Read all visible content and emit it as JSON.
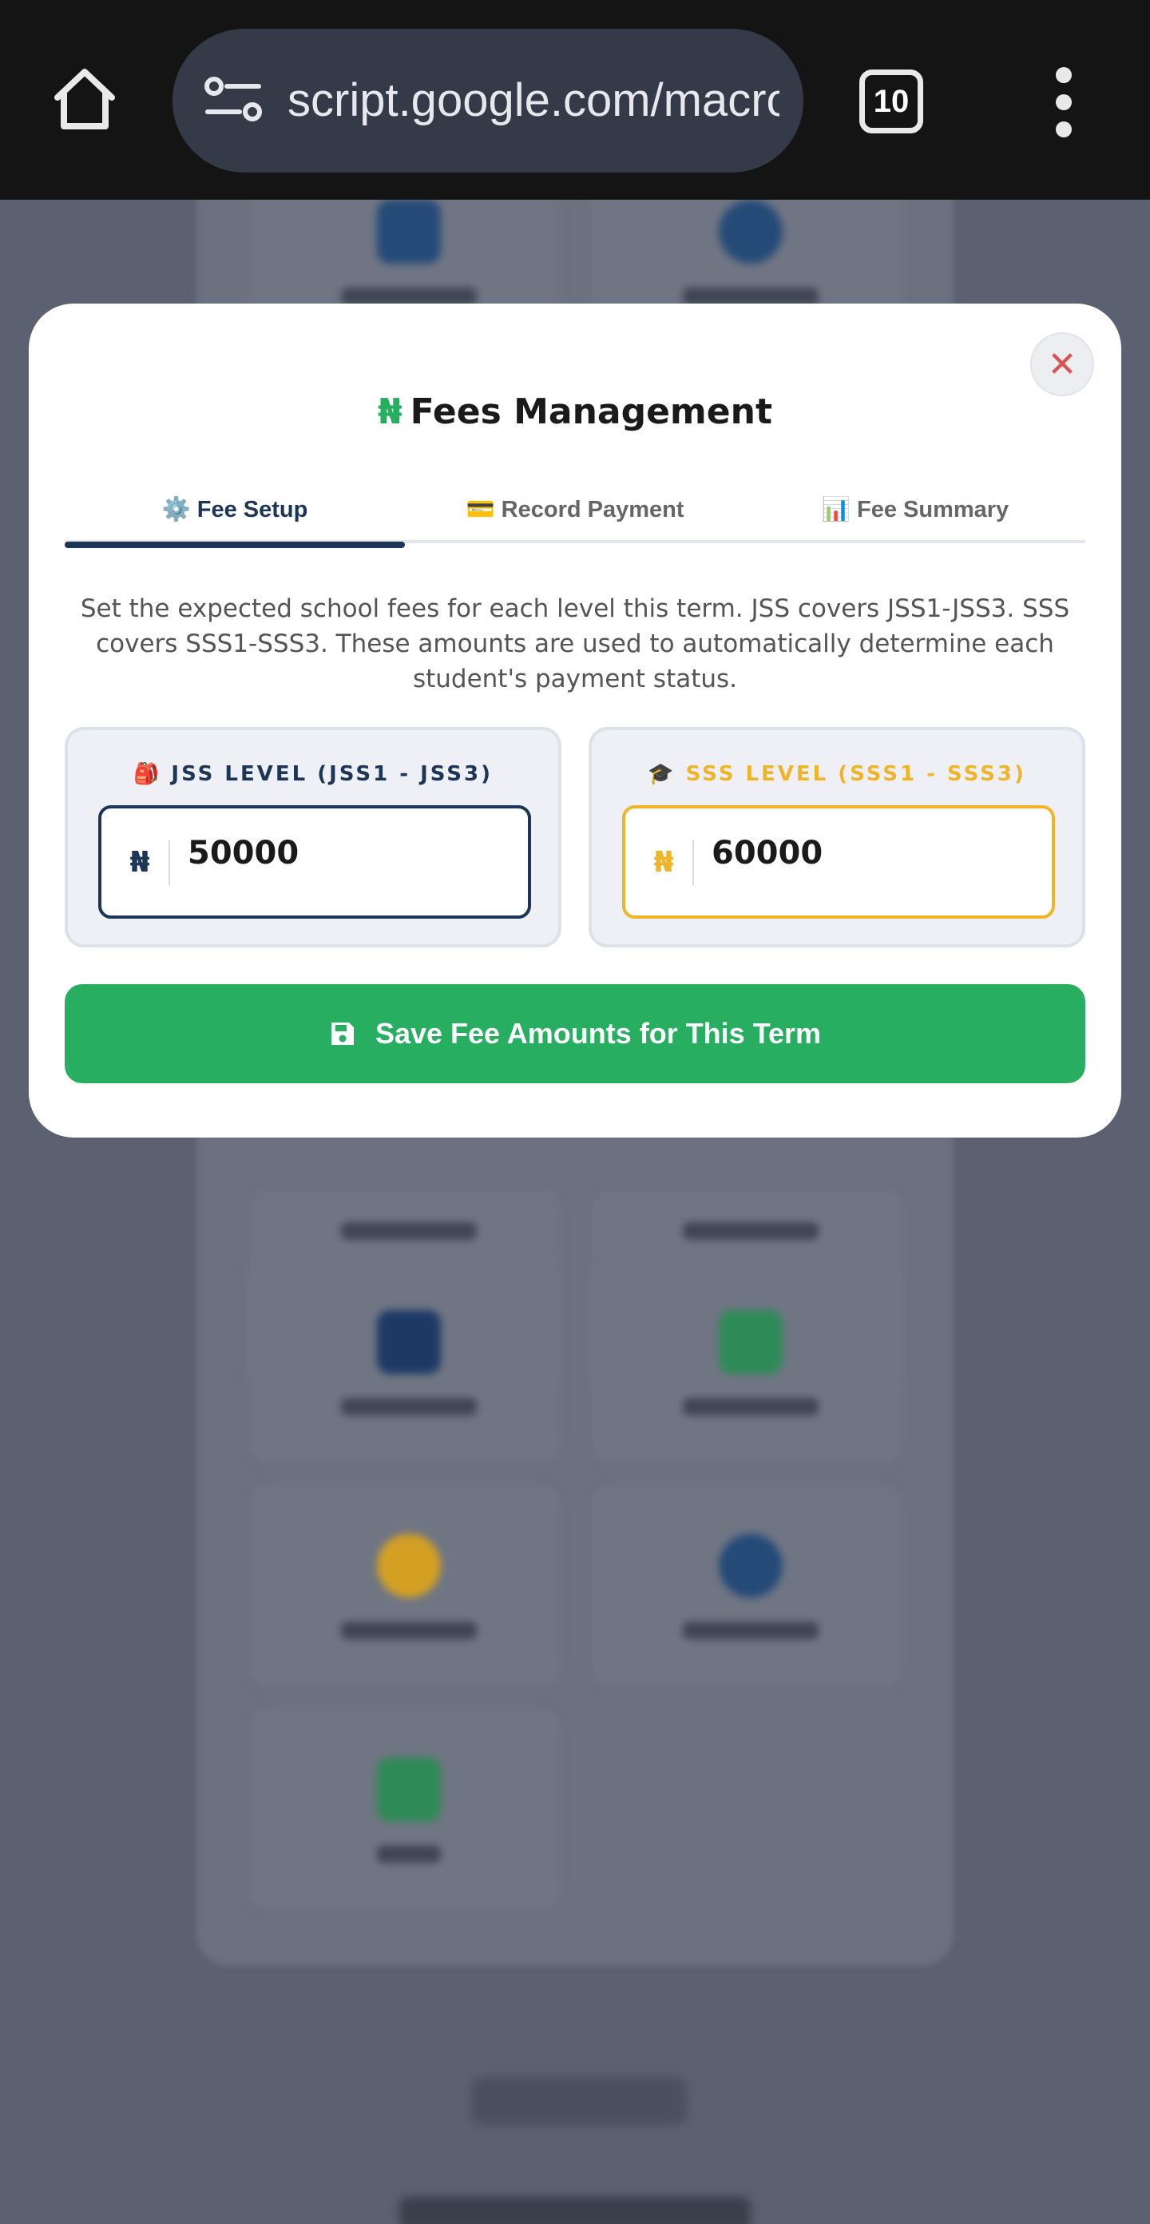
{
  "browser": {
    "url": "script.google.com/macros",
    "tab_count": "10"
  },
  "modal": {
    "title_symbol": "₦",
    "title": "Fees Management",
    "close_symbol": "✕",
    "tabs": [
      {
        "label": "⚙️ Fee Setup",
        "active": true
      },
      {
        "label": "💳 Record Payment",
        "active": false
      },
      {
        "label": "📊 Fee Summary",
        "active": false
      }
    ],
    "description": "Set the expected school fees for each level this term. JSS covers JSS1-JSS3. SSS covers SSS1-SSS3. These amounts are used to automatically determine each student's payment status.",
    "jss": {
      "label": "🎒 JSS LEVEL (JSS1 - JSS3)",
      "currency": "₦",
      "value": "50000"
    },
    "sss": {
      "label": "🎓 SSS LEVEL (SSS1 - SSS3)",
      "currency": "₦",
      "value": "60000"
    },
    "save_label": "Save Fee Amounts for This Term"
  },
  "colors": {
    "navy": "#1d3557",
    "gold": "#f0b429",
    "green": "#27ae60",
    "close_red": "#d9534f"
  }
}
